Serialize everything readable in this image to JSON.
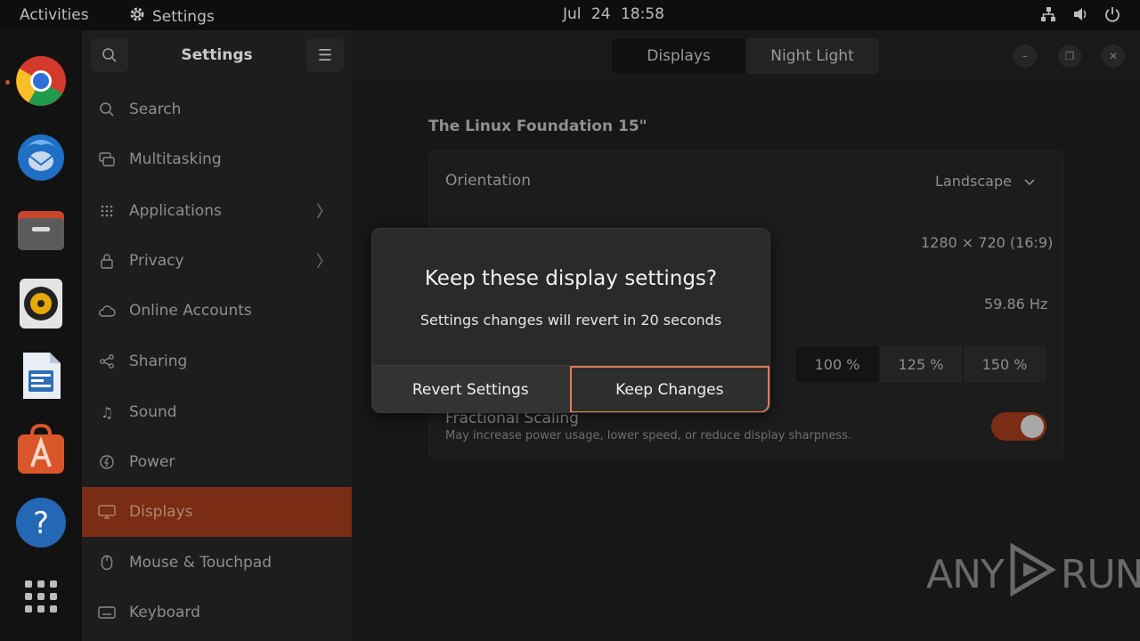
{
  "topbar": {
    "activities": "Activities",
    "app_name": "Settings",
    "clock": "Jul 24  18:58"
  },
  "dock": {
    "items": [
      "chrome-icon",
      "thunderbird-icon",
      "files-icon",
      "rhythmbox-icon",
      "writer-icon",
      "app-center-icon",
      "help-icon",
      "show-apps-icon"
    ]
  },
  "sidebar": {
    "title": "Settings",
    "items": [
      {
        "label": "Search",
        "icon": "search-icon"
      },
      {
        "label": "Multitasking",
        "icon": "multitasking-icon"
      },
      {
        "label": "Applications",
        "icon": "apps-grid-icon"
      },
      {
        "label": "Privacy",
        "icon": "lock-icon"
      },
      {
        "label": "Online Accounts",
        "icon": "cloud-icon"
      },
      {
        "label": "Sharing",
        "icon": "share-icon"
      },
      {
        "label": "Sound",
        "icon": "music-note-icon"
      },
      {
        "label": "Power",
        "icon": "power-icon"
      },
      {
        "label": "Displays",
        "icon": "monitor-icon"
      },
      {
        "label": "Mouse & Touchpad",
        "icon": "mouse-icon"
      },
      {
        "label": "Keyboard",
        "icon": "keyboard-icon"
      }
    ],
    "active": "Displays"
  },
  "header": {
    "tabs": [
      "Displays",
      "Night Light"
    ],
    "active_tab": "Displays"
  },
  "display": {
    "monitor_name": "The Linux Foundation 15\"",
    "orientation_label": "Orientation",
    "orientation_value": "Landscape",
    "resolution_value": "1280 × 720 (16:9)",
    "refresh_value": "59.86 Hz",
    "scale_options": [
      "100 %",
      "125 %",
      "150 %"
    ],
    "scale_selected": "100 %",
    "fractional_label": "Fractional Scaling",
    "fractional_sub": "May increase power usage, lower speed, or reduce display sharpness.",
    "fractional_enabled": true
  },
  "dialog": {
    "title": "Keep these display settings?",
    "message": "Settings changes will revert in 20 seconds",
    "revert_label": "Revert Settings",
    "keep_label": "Keep Changes"
  },
  "watermark": {
    "text_left": "ANY",
    "text_right": "RUN"
  },
  "colors": {
    "accent": "#e95420",
    "active_row": "#7a2c14"
  }
}
